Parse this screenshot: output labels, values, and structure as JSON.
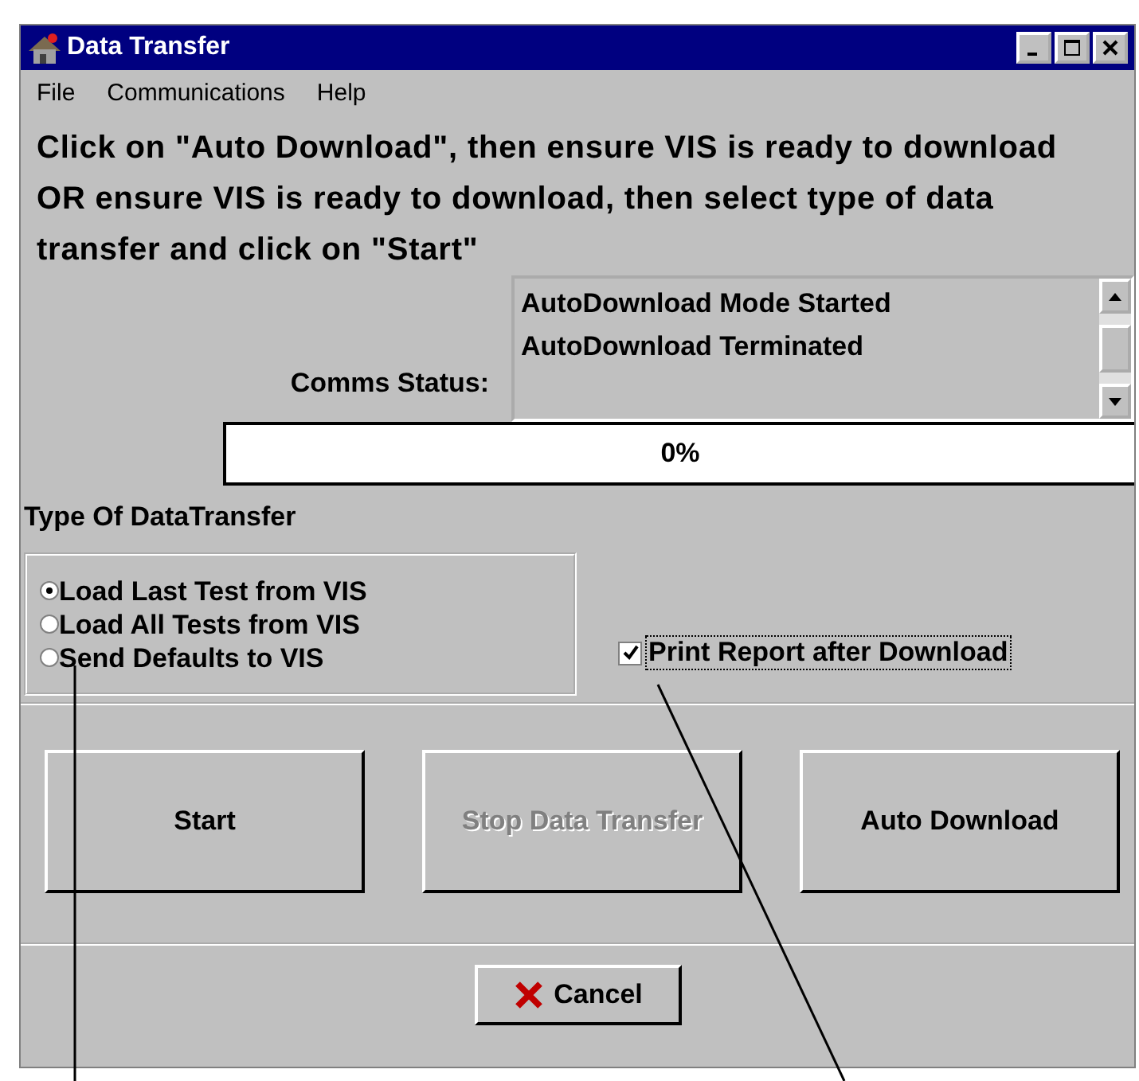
{
  "window": {
    "title": "Data Transfer"
  },
  "menu": [
    "File",
    "Communications",
    "Help"
  ],
  "instructions": "Click on \"Auto Download\", then ensure VIS is ready to download OR ensure VIS is ready to download, then select type of data transfer and click on \"Start\"",
  "comms_status": {
    "label": "Comms Status:",
    "lines": [
      "AutoDownload Mode Started",
      "AutoDownload Terminated"
    ]
  },
  "progress": {
    "text": "0%",
    "level": 0
  },
  "transfer_type": {
    "heading": "Type Of DataTransfer",
    "options": [
      {
        "label": "Load Last Test from VIS",
        "selected": true
      },
      {
        "label": "Load All Tests from VIS",
        "selected": false
      },
      {
        "label": "Send Defaults to VIS",
        "selected": false
      }
    ]
  },
  "print_report": {
    "label": "Print Report after Download",
    "checked": true
  },
  "buttons": [
    {
      "label": "Start",
      "disabled": false
    },
    {
      "label": "Stop Data Transfer",
      "disabled": true
    },
    {
      "label": "Auto Download",
      "disabled": false
    }
  ],
  "cancel": {
    "label": "Cancel"
  }
}
